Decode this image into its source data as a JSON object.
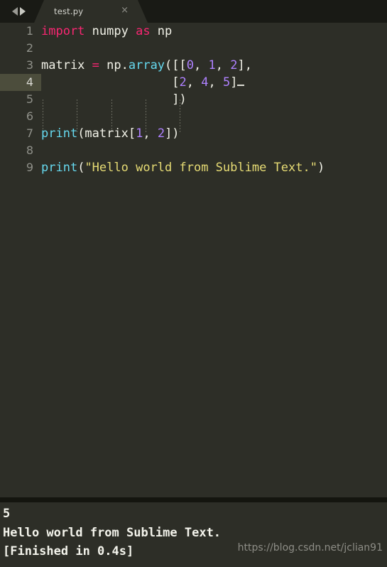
{
  "window": {
    "app": "Sublime Text",
    "theme_colors": {
      "editor_background": "#2d2e27",
      "tabbar_background": "#191a15",
      "active_line_gutter": "#4c4d3c",
      "separator": "#14150f",
      "keyword": "#f92672",
      "function": "#66d9ef",
      "number": "#ae81ff",
      "string": "#e6db74",
      "plain_text": "#f2f2e8",
      "line_number": "#8f9089"
    }
  },
  "tabbar": {
    "nav_prev_icon": "arrow-left-icon",
    "nav_next_icon": "arrow-right-icon",
    "tabs": [
      {
        "label": "test.py",
        "close_icon": "close-icon",
        "close_glyph": "×",
        "active": true
      }
    ]
  },
  "editor": {
    "active_line": 4,
    "line_numbers": [
      "1",
      "2",
      "3",
      "4",
      "5",
      "6",
      "7",
      "8",
      "9"
    ],
    "lines": [
      {
        "number": "1",
        "text": "import numpy as np",
        "tokens": [
          {
            "t": "import",
            "c": "kw"
          },
          {
            "t": " numpy ",
            "c": "pl"
          },
          {
            "t": "as",
            "c": "kw"
          },
          {
            "t": " np",
            "c": "pl"
          }
        ]
      },
      {
        "number": "2",
        "text": "",
        "tokens": []
      },
      {
        "number": "3",
        "text": "matrix = np.array([[0, 1, 2],",
        "tokens": [
          {
            "t": "matrix ",
            "c": "pl"
          },
          {
            "t": "=",
            "c": "op"
          },
          {
            "t": " np.",
            "c": "pl"
          },
          {
            "t": "array",
            "c": "fn"
          },
          {
            "t": "([[",
            "c": "pl"
          },
          {
            "t": "0",
            "c": "num"
          },
          {
            "t": ", ",
            "c": "pl"
          },
          {
            "t": "1",
            "c": "num"
          },
          {
            "t": ", ",
            "c": "pl"
          },
          {
            "t": "2",
            "c": "num"
          },
          {
            "t": "],",
            "c": "pl"
          }
        ]
      },
      {
        "number": "4",
        "text": "                  [2, 4, 5]",
        "tokens": [
          {
            "t": "                  [",
            "c": "pl"
          },
          {
            "t": "2",
            "c": "num"
          },
          {
            "t": ", ",
            "c": "pl"
          },
          {
            "t": "4",
            "c": "num"
          },
          {
            "t": ", ",
            "c": "pl"
          },
          {
            "t": "5",
            "c": "num"
          },
          {
            "t": "]",
            "c": "pl"
          }
        ]
      },
      {
        "number": "5",
        "text": "                  ])",
        "tokens": [
          {
            "t": "                  ])",
            "c": "pl"
          }
        ]
      },
      {
        "number": "6",
        "text": "",
        "tokens": []
      },
      {
        "number": "7",
        "text": "print(matrix[1, 2])",
        "tokens": [
          {
            "t": "print",
            "c": "fn"
          },
          {
            "t": "(matrix[",
            "c": "pl"
          },
          {
            "t": "1",
            "c": "num"
          },
          {
            "t": ", ",
            "c": "pl"
          },
          {
            "t": "2",
            "c": "num"
          },
          {
            "t": "])",
            "c": "pl"
          }
        ]
      },
      {
        "number": "8",
        "text": "",
        "tokens": []
      },
      {
        "number": "9",
        "text": "print(\"Hello world from Sublime Text.\")",
        "tokens": [
          {
            "t": "print",
            "c": "fn"
          },
          {
            "t": "(",
            "c": "pl"
          },
          {
            "t": "\"Hello world from Sublime Text.\"",
            "c": "str"
          },
          {
            "t": ")",
            "c": "pl"
          }
        ]
      }
    ]
  },
  "output_panel": {
    "lines": [
      "5",
      "Hello world from Sublime Text.",
      "[Finished in 0.4s]"
    ],
    "watermark": "https://blog.csdn.net/jclian91"
  }
}
